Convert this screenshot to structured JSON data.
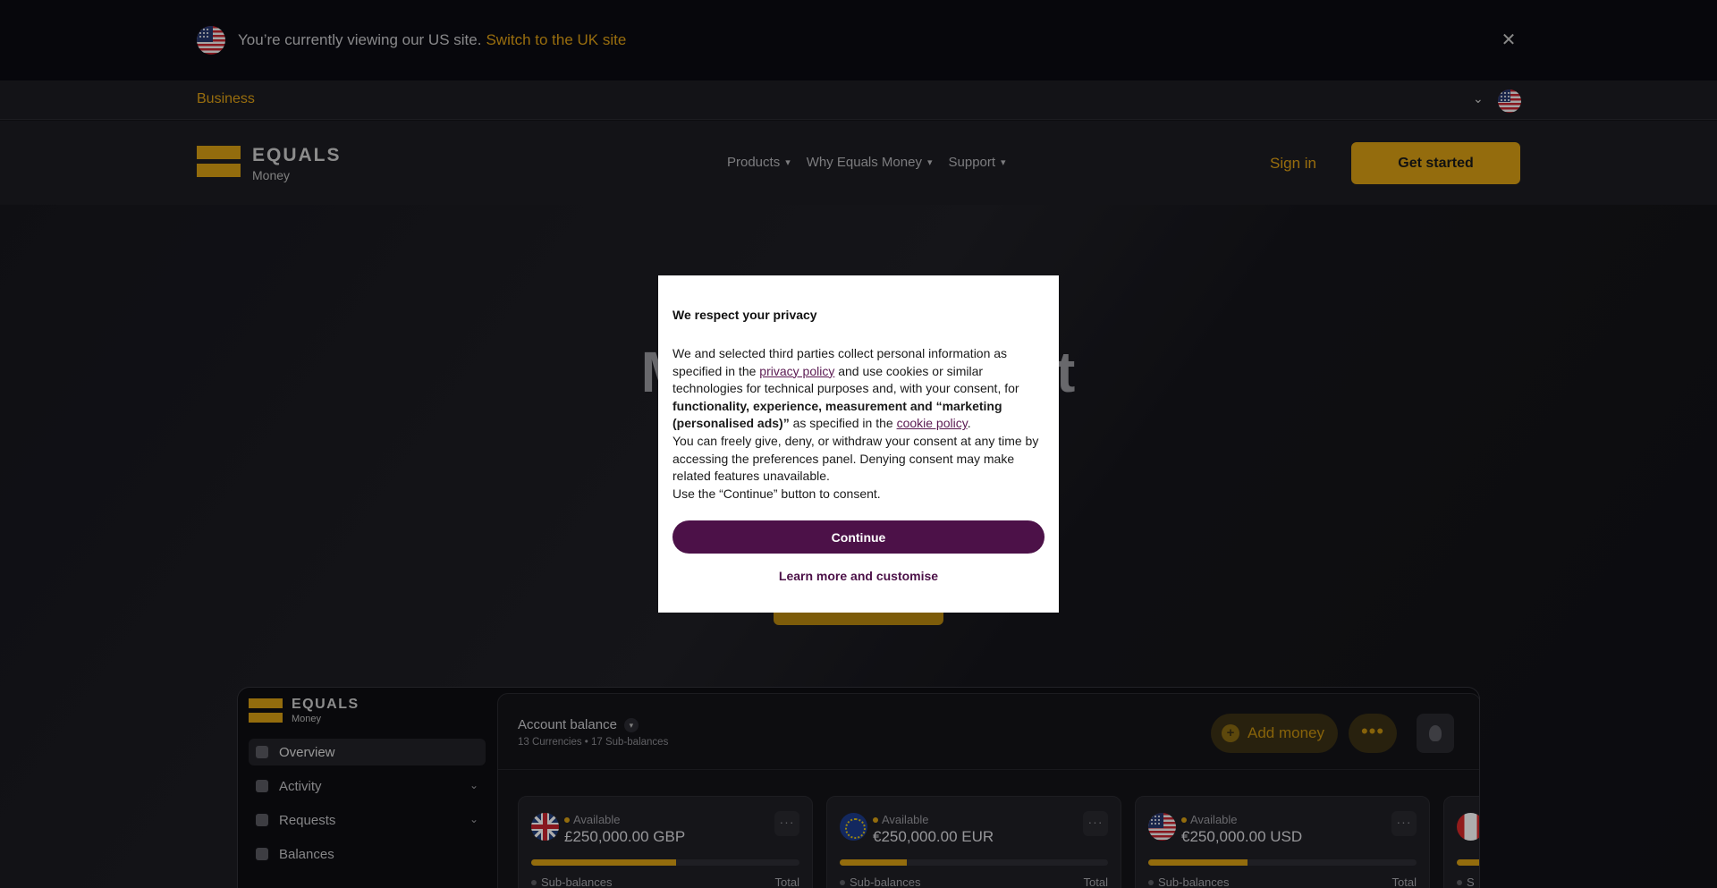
{
  "banner": {
    "text": "You’re currently viewing our US site.",
    "link": "Switch to the UK site",
    "close_icon": "close-icon",
    "flag_icon": "us-flag-icon"
  },
  "business_bar": {
    "label": "Business",
    "chevron_icon": "chevron-down-icon",
    "flag_icon": "us-flag-icon"
  },
  "nav": {
    "logo_title": "EQUALS",
    "logo_sub": "Money",
    "items": [
      "Products",
      "Why Equals Money",
      "Support"
    ],
    "sign_in": "Sign in",
    "get_started": "Get started"
  },
  "hero": {
    "title_visible": "M                    nt"
  },
  "dashboard": {
    "logo_title": "EQUALS",
    "logo_sub": "Money",
    "sidebar": [
      {
        "label": "Overview",
        "icon": "home-icon",
        "active": true,
        "has_chevron": false
      },
      {
        "label": "Activity",
        "icon": "document-icon",
        "active": false,
        "has_chevron": true
      },
      {
        "label": "Requests",
        "icon": "requests-icon",
        "active": false,
        "has_chevron": true
      },
      {
        "label": "Balances",
        "icon": "balances-icon",
        "active": false,
        "has_chevron": false
      }
    ],
    "account_title": "Account balance",
    "account_sub": "13 Currencies • 17 Sub-balances",
    "add_money": "Add money",
    "more_label": "•••",
    "cards": [
      {
        "flag": "gb-flag-icon",
        "available": "Available",
        "amount": "£250,000.00 GBP",
        "progress": 0.54,
        "sub": "Sub-balances",
        "total": "Total"
      },
      {
        "flag": "eu-flag-icon",
        "available": "Available",
        "amount": "€250,000.00 EUR",
        "progress": 0.25,
        "sub": "Sub-balances",
        "total": "Total"
      },
      {
        "flag": "us-flag-icon",
        "available": "Available",
        "amount": "€250,000.00 USD",
        "progress": 0.37,
        "sub": "Sub-balances",
        "total": "Total"
      },
      {
        "flag": "ca-flag-icon",
        "available": "",
        "amount": "",
        "progress": 0.3,
        "sub": "S",
        "total": ""
      }
    ],
    "card_more": "···"
  },
  "privacy_modal": {
    "title": "We respect your privacy",
    "p1_a": "We and selected third parties collect personal information as specified in the ",
    "privacy_link": "privacy policy",
    "p1_b": " and use cookies or similar technologies for technical purposes and, with your consent, for ",
    "p1_bold": "functionality, experience, measurement and “marketing (personalised ads)”",
    "p1_c": " as specified in the ",
    "cookie_link": "cookie policy",
    "p1_d": ".",
    "p2": "You can freely give, deny, or withdraw your consent at any time by accessing the preferences panel. Denying consent may make related features unavailable.",
    "p3": "Use the “Continue” button to consent.",
    "continue": "Continue",
    "learn_more": "Learn more and customise"
  },
  "colors": {
    "accent": "#dba014",
    "link_gold": "#e0a115",
    "modal_purple": "#4c1148"
  }
}
